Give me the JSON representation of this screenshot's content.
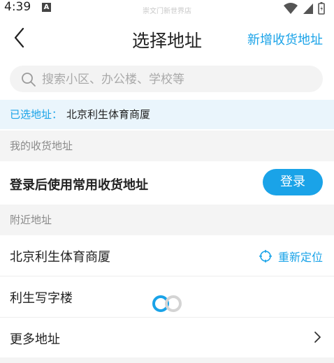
{
  "status_bar": {
    "time": "4:39",
    "app_badge": "A",
    "watermark": "崇文门新世界店"
  },
  "header": {
    "title": "选择地址",
    "add_address": "新增收货地址"
  },
  "search": {
    "placeholder": "搜索小区、办公楼、学校等",
    "value": ""
  },
  "selected": {
    "label": "已选地址：",
    "value": "北京利生体育商厦"
  },
  "my_addresses": {
    "section_title": "我的收货地址",
    "login_prompt": "登录后使用常用收货地址",
    "login_button": "登录"
  },
  "nearby": {
    "section_title": "附近地址",
    "items": [
      {
        "name": "北京利生体育商厦",
        "action": "重新定位"
      },
      {
        "name": "利生写字楼"
      }
    ],
    "more": "更多地址"
  },
  "colors": {
    "accent": "#1aa3e8",
    "selected_bg": "#eaf5fc",
    "section_bg": "#f4f4f4"
  },
  "icons": [
    "back-arrow-icon",
    "search-icon",
    "locate-icon",
    "chevron-right-icon",
    "loading-spinner-icon",
    "wifi-icon",
    "signal-icon",
    "battery-icon"
  ]
}
